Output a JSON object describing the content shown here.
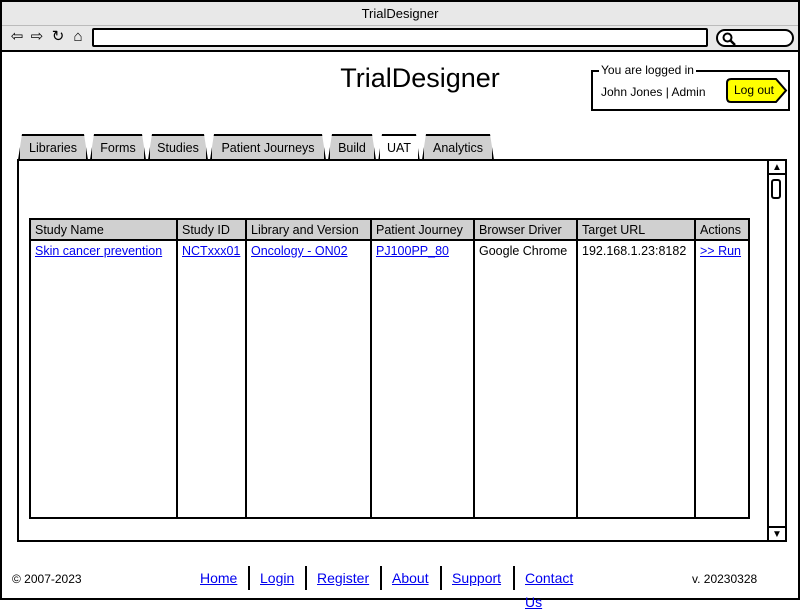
{
  "window": {
    "title": "TrialDesigner"
  },
  "browser": {
    "url_value": "",
    "search_value": ""
  },
  "header": {
    "app_title": "TrialDesigner",
    "login_legend": "You are logged in",
    "user_text": "John Jones | Admin",
    "logout_label": "Log out",
    "logout_color": "#ffff00"
  },
  "tabs": [
    {
      "label": "Libraries"
    },
    {
      "label": "Forms"
    },
    {
      "label": "Studies"
    },
    {
      "label": "Patient Journeys"
    },
    {
      "label": "Build"
    },
    {
      "label": "UAT",
      "active": true
    },
    {
      "label": "Analytics"
    }
  ],
  "table": {
    "columns": [
      "Study Name",
      "Study ID",
      "Library and Version",
      "Patient Journey",
      "Browser Driver",
      "Target URL",
      "Actions"
    ],
    "rows": [
      {
        "study_name": "Skin cancer prevention",
        "study_id": "NCTxxx01",
        "library_version": "Oncology - ON02",
        "patient_journey": "PJ100PP_80",
        "browser_driver": "Google Chrome",
        "target_url": "192.168.1.23:8182",
        "action": ">> Run"
      }
    ]
  },
  "footer": {
    "copyright": "© 2007-2023",
    "version": "v. 20230328",
    "links": [
      "Home",
      "Login",
      "Register",
      "About",
      "Support",
      "Contact Us"
    ]
  },
  "colors": {
    "link": "#0000ee",
    "tab_bg": "#d0d0d0",
    "header_bg": "#d0d0d0"
  }
}
